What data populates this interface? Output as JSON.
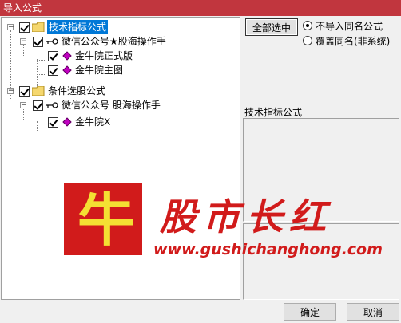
{
  "window": {
    "title": "导入公式"
  },
  "tree": {
    "nodes": [
      {
        "label": "技术指标公式"
      },
      {
        "label": "微信公众号★股海操作手"
      },
      {
        "label": "金牛院正式版"
      },
      {
        "label": "金牛院主图"
      },
      {
        "label": "条件选股公式"
      },
      {
        "label": "微信公众号 股海操作手"
      },
      {
        "label": "金牛院X"
      }
    ]
  },
  "options": {
    "select_all_label": "全部选中",
    "radio_no_import": "不导入同名公式",
    "radio_overwrite": "覆盖同名(非系统)",
    "selected_radio": "不导入同名公式"
  },
  "detail": {
    "title": "技术指标公式"
  },
  "watermark": {
    "logo_char": "牛",
    "brand_name": "股市长红",
    "url": "www.gushichanghong.com"
  },
  "footer": {
    "ok_label": "确定",
    "cancel_label": "取消"
  }
}
